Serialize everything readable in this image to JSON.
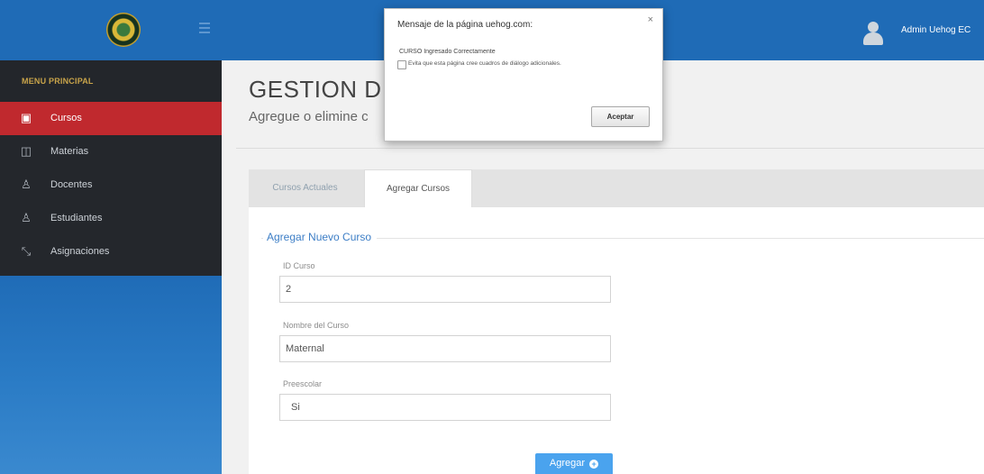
{
  "header": {
    "user_name": "Admin Uehog EC"
  },
  "sidebar": {
    "menu_title": "MENU PRINCIPAL",
    "items": [
      {
        "label": "Cursos",
        "icon": "book-icon",
        "active": true
      },
      {
        "label": "Materias",
        "icon": "open-book-icon",
        "active": false
      },
      {
        "label": "Docentes",
        "icon": "user-icon",
        "active": false
      },
      {
        "label": "Estudiantes",
        "icon": "user-icon",
        "active": false
      },
      {
        "label": "Asignaciones",
        "icon": "link-icon",
        "active": false
      }
    ]
  },
  "main": {
    "title": "GESTION D",
    "subtitle": "Agregue o elimine c",
    "tabs": [
      {
        "label": "Cursos Actuales",
        "active": false
      },
      {
        "label": "Agregar Cursos",
        "active": true
      }
    ],
    "form": {
      "legend": "Agregar Nuevo Curso",
      "fields": [
        {
          "label": "ID Curso",
          "value": "2"
        },
        {
          "label": "Nombre del Curso",
          "value": "Maternal"
        },
        {
          "label": "Preescolar",
          "value": "Si"
        }
      ],
      "submit_label": "Agregar"
    }
  },
  "dialog": {
    "title": "Mensaje de la página uehog.com:",
    "message": "CURSO Ingresado Correctamente",
    "checkbox_label": "Evita que esta página cree cuadros de diálogo adicionales.",
    "ok_label": "Aceptar",
    "close_symbol": "×"
  },
  "colors": {
    "sidebar_blue": "#1f6bb6",
    "active_red": "#c0292e",
    "menu_dark": "#24272c",
    "button_blue": "#4aa3ee"
  }
}
